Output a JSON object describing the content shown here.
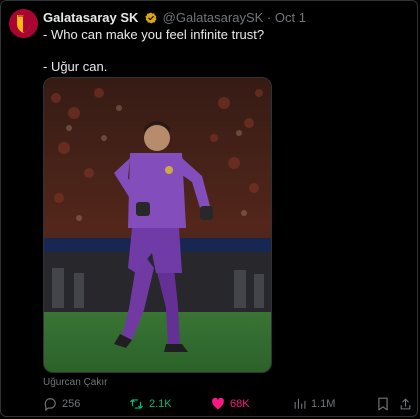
{
  "tweet": {
    "author_name": "Galatasaray SK",
    "handle": "@GalatasaraySK",
    "separator": "·",
    "date": "Oct 1",
    "text_lines": [
      "- Who can make you feel infinite trust?",
      "- Uğur can."
    ],
    "media_credit": "Uğurcan Çakır",
    "stats": {
      "replies": "256",
      "retweets": "2.1K",
      "likes": "68K",
      "views": "1.1M"
    }
  },
  "colors": {
    "background": "#000000",
    "text": "#e7e9ea",
    "muted": "#71767b",
    "verified": "#d8a514",
    "retweet_active": "#00ba7c",
    "like_active": "#f91880"
  },
  "icons": [
    "galatasaray-logo-icon",
    "verified-badge-icon",
    "reply-icon",
    "retweet-icon",
    "heart-icon",
    "views-icon",
    "bookmark-icon",
    "share-icon"
  ]
}
